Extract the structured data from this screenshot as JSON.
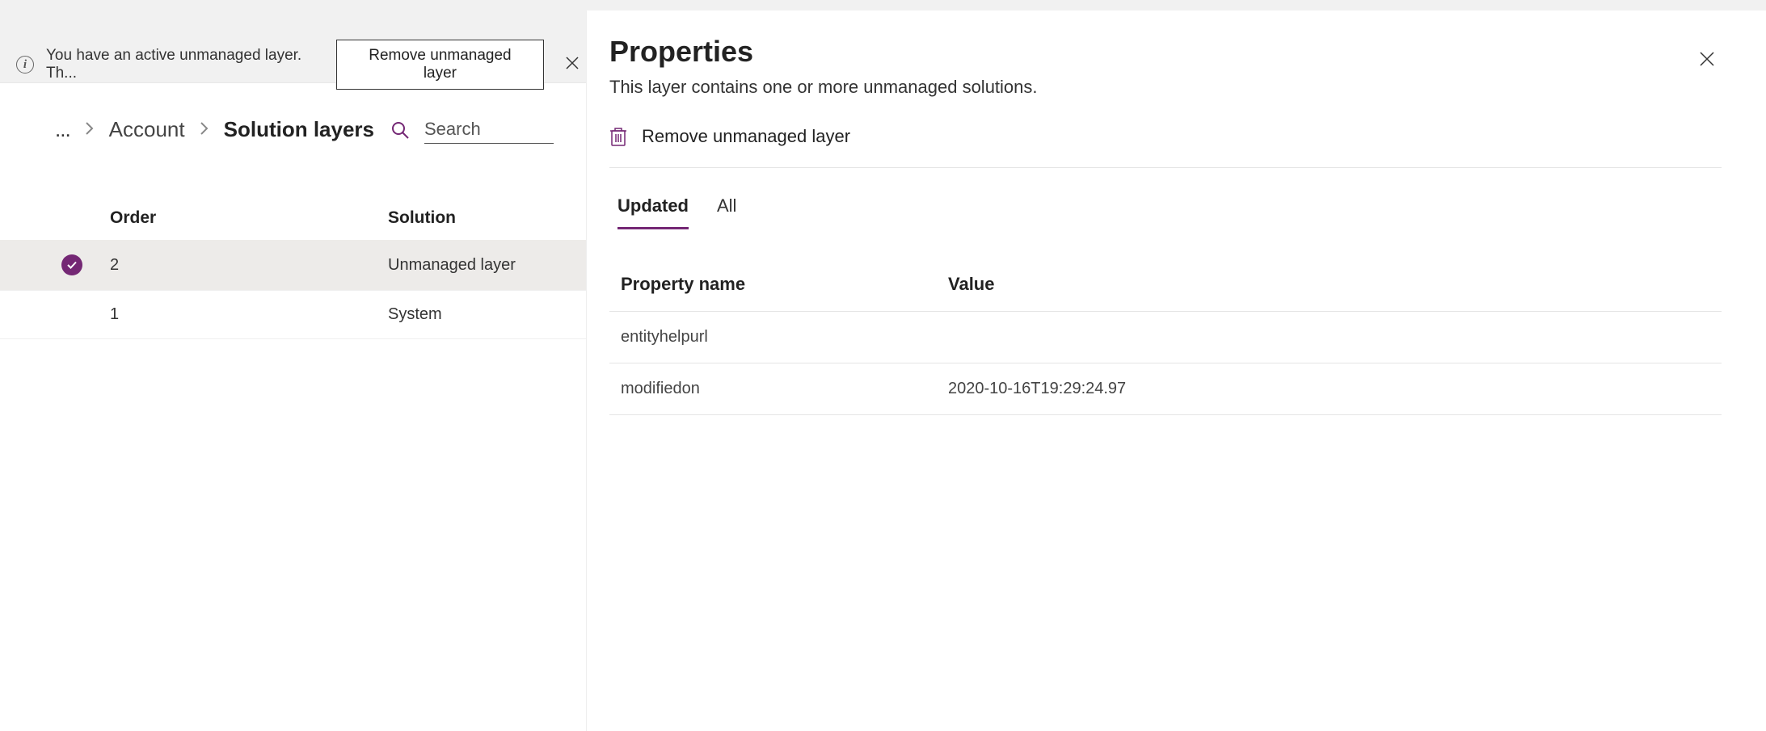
{
  "notification": {
    "message": "You have an active unmanaged layer. Th...",
    "button_label": "Remove unmanaged layer"
  },
  "breadcrumb": {
    "parent": "Account",
    "current": "Solution layers"
  },
  "search": {
    "placeholder": "Search"
  },
  "layers_table": {
    "headers": {
      "order": "Order",
      "solution": "Solution"
    },
    "rows": [
      {
        "order": "2",
        "solution": "Unmanaged layer",
        "selected": true
      },
      {
        "order": "1",
        "solution": "System",
        "selected": false
      }
    ]
  },
  "properties": {
    "title": "Properties",
    "subtitle": "This layer contains one or more unmanaged solutions.",
    "remove_action": "Remove unmanaged layer",
    "tabs": {
      "updated": "Updated",
      "all": "All"
    },
    "table_head": {
      "name": "Property name",
      "value": "Value"
    },
    "rows": [
      {
        "name": "entityhelpurl",
        "value": ""
      },
      {
        "name": "modifiedon",
        "value": "2020-10-16T19:29:24.97"
      }
    ]
  }
}
